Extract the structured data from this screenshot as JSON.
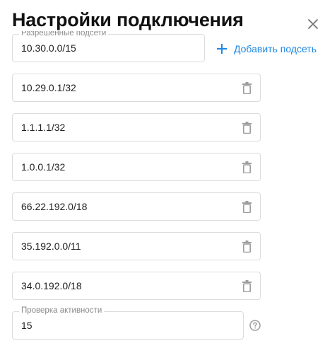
{
  "dialog": {
    "title": "Настройки подключения",
    "close_icon": "close-icon"
  },
  "subnets": {
    "label": "Разрешенные подсети",
    "first_value": "10.30.0.0/15",
    "add_label": "Добавить подсеть",
    "add_icon": "plus-icon",
    "items": [
      {
        "value": "10.29.0.1/32",
        "icon": "trash-icon"
      },
      {
        "value": "1.1.1.1/32",
        "icon": "trash-icon"
      },
      {
        "value": "1.0.0.1/32",
        "icon": "trash-icon"
      },
      {
        "value": "66.22.192.0/18",
        "icon": "trash-icon"
      },
      {
        "value": "35.192.0.0/11",
        "icon": "trash-icon"
      },
      {
        "value": "34.0.192.0/18",
        "icon": "trash-icon"
      }
    ]
  },
  "keepalive": {
    "label": "Проверка активности",
    "value": "15",
    "help_icon": "help-circle-icon"
  },
  "colors": {
    "accent": "#1e88e5",
    "border": "#dcdcdc",
    "icon": "#9e9e9e",
    "label": "#8a8a8a"
  }
}
